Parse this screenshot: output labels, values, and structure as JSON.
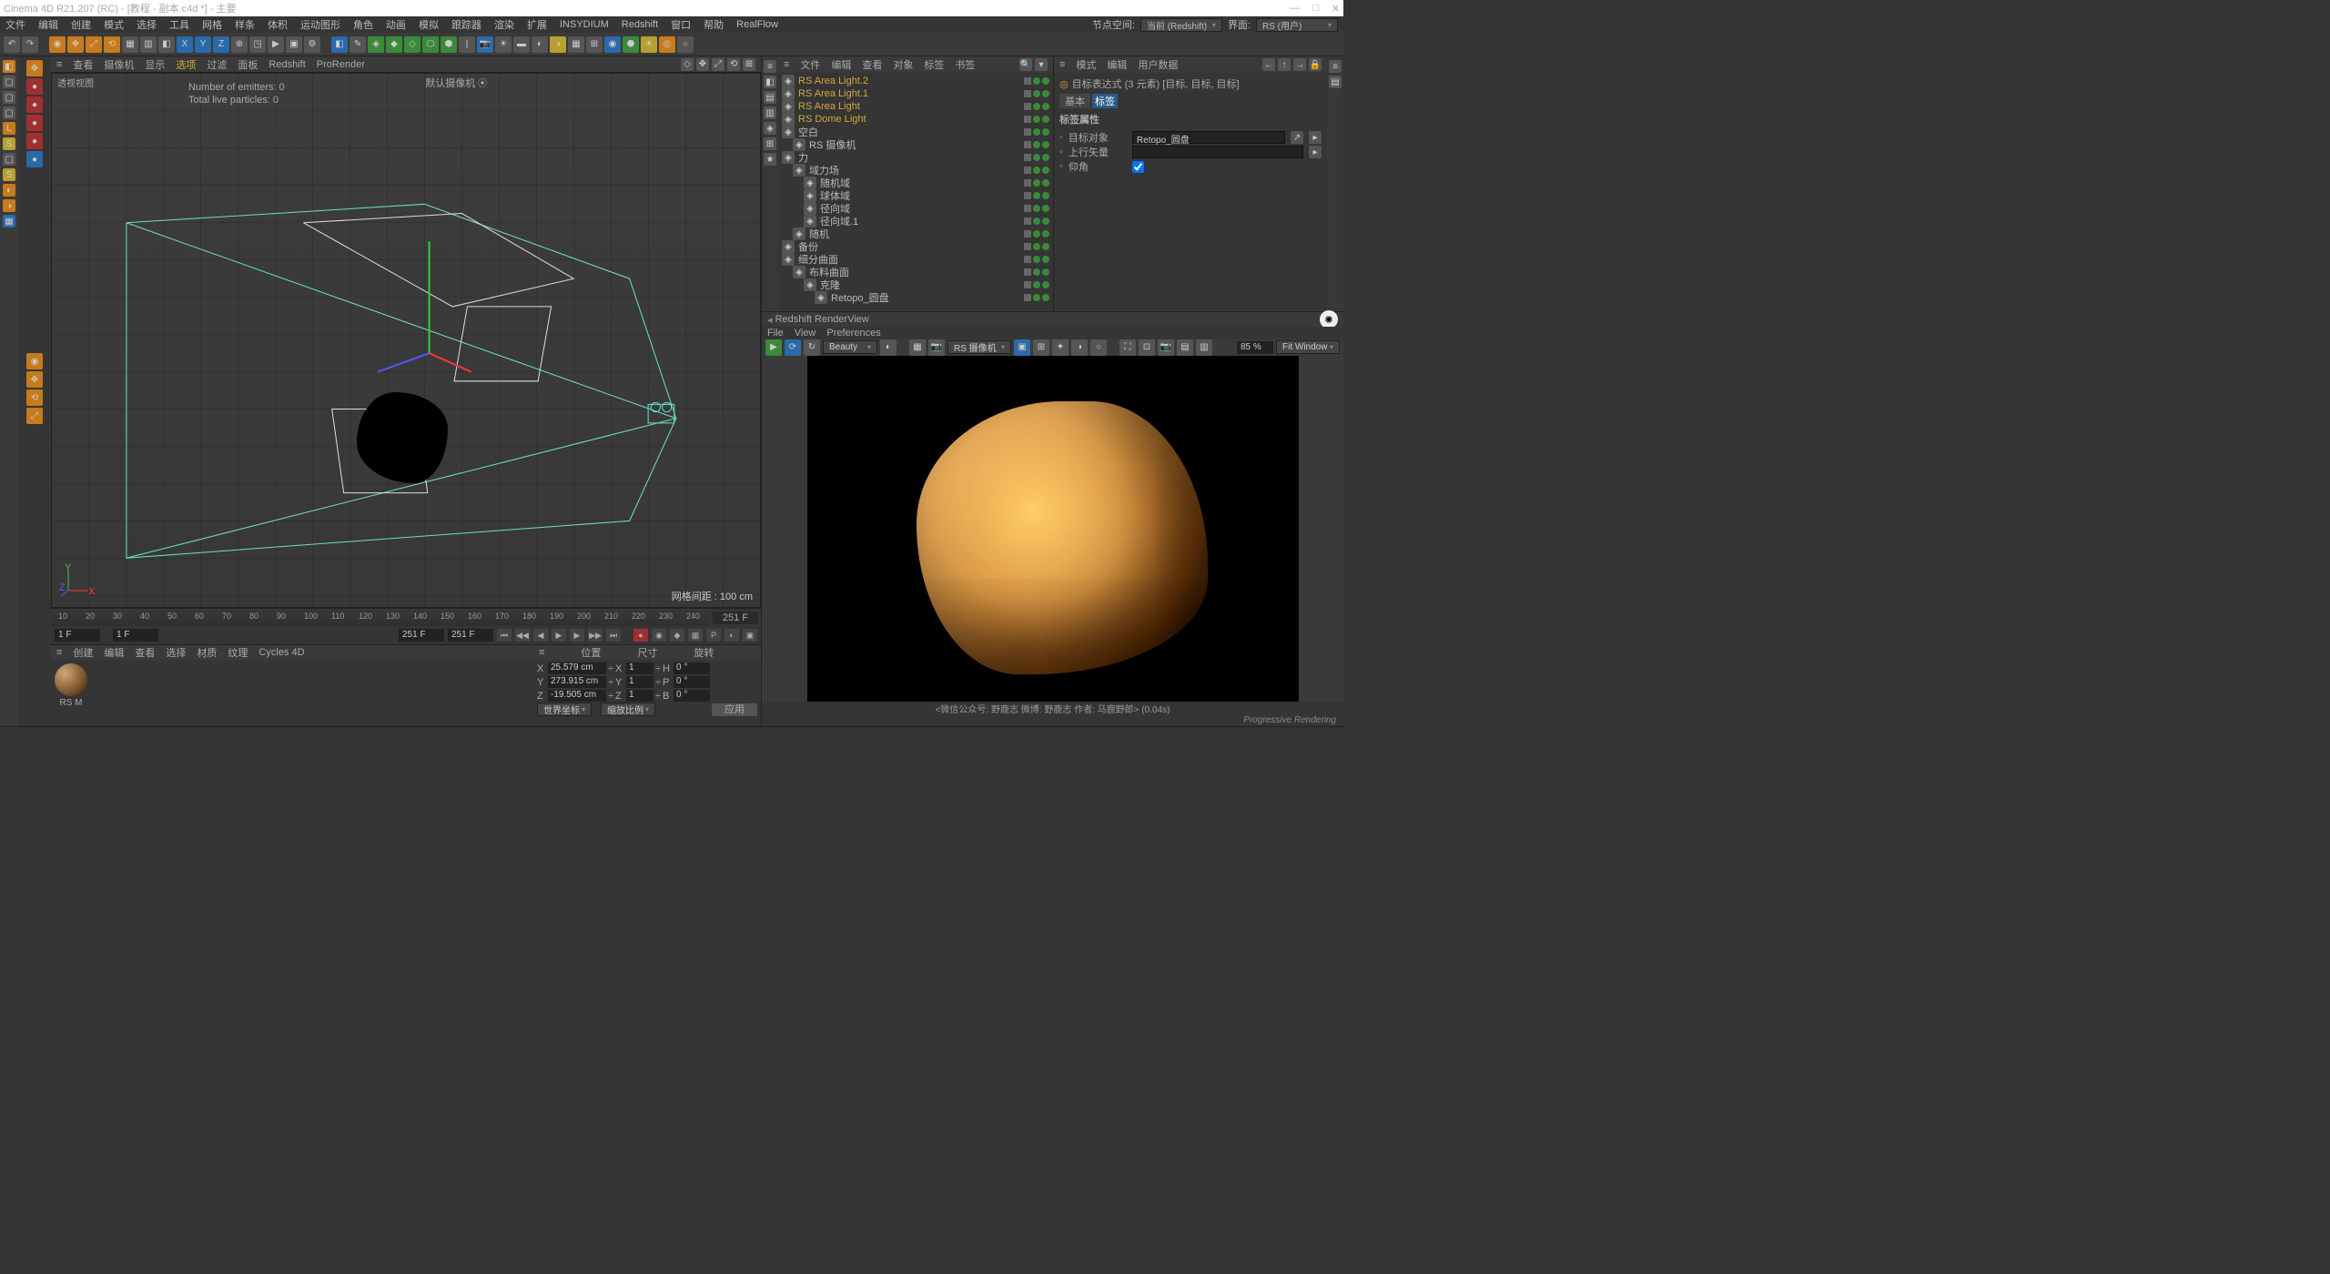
{
  "title": "Cinema 4D R21.207 (RC) - [教程 - 副本.c4d *] - 主要",
  "menu": [
    "文件",
    "编辑",
    "创建",
    "模式",
    "选择",
    "工具",
    "网格",
    "样条",
    "体积",
    "运动图形",
    "角色",
    "动画",
    "模拟",
    "跟踪器",
    "渲染",
    "扩展",
    "INSYDIUM",
    "Redshift",
    "窗口",
    "帮助",
    "RealFlow"
  ],
  "menuRight": {
    "nodeSpace": "节点空间:",
    "nodeSpaceVal": "当前 (Redshift)",
    "layout": "界面:",
    "layoutVal": "RS (用户)"
  },
  "vpMenu": [
    "查看",
    "摄像机",
    "显示",
    "选项",
    "过滤",
    "面板",
    "Redshift",
    "ProRender"
  ],
  "vpLabel": "透视视图",
  "vpCam": "默认摄像机",
  "emit": {
    "l1": "Number of emitters: 0",
    "l2": "Total live particles: 0"
  },
  "gridInfo": "网格间距 : 100 cm",
  "objTabs": [
    "文件",
    "编辑",
    "查看",
    "对象",
    "标签",
    "书签"
  ],
  "objects": [
    {
      "n": "RS Area Light.2",
      "cls": "or",
      "i": 0
    },
    {
      "n": "RS Area Light.1",
      "cls": "or",
      "i": 0
    },
    {
      "n": "RS Area Light",
      "cls": "or",
      "i": 0
    },
    {
      "n": "RS Dome Light",
      "cls": "or",
      "i": 0
    },
    {
      "n": "空白",
      "i": 0
    },
    {
      "n": "RS 摄像机",
      "i": 1
    },
    {
      "n": "力",
      "i": 0
    },
    {
      "n": "域力场",
      "i": 1
    },
    {
      "n": "随机域",
      "i": 2
    },
    {
      "n": "球体域",
      "i": 2
    },
    {
      "n": "径向域",
      "i": 2
    },
    {
      "n": "径向域.1",
      "i": 2
    },
    {
      "n": "随机",
      "i": 1
    },
    {
      "n": "备份",
      "i": 0
    },
    {
      "n": "细分曲面",
      "i": 0
    },
    {
      "n": "布料曲面",
      "i": 1
    },
    {
      "n": "克隆",
      "i": 2
    },
    {
      "n": "Retopo_圆盘",
      "i": 3
    }
  ],
  "attrTabs": [
    "模式",
    "编辑",
    "用户数据"
  ],
  "attrTitle": "目标表达式 (3 元素) [目标, 目标, 目标]",
  "attrSubTabs": {
    "a": "基本",
    "b": "标签"
  },
  "attrSection": "标签属性",
  "attrRows": {
    "target": "目标对象",
    "targetVal": "Retopo_圆盘",
    "up": "上行矢量",
    "pitch": "仰角"
  },
  "rv": {
    "title": "Redshift RenderView",
    "menu": [
      "File",
      "View",
      "Preferences"
    ],
    "aov": "Beauty",
    "cam": "RS 摄像机",
    "pct": "85 %",
    "fit": "Fit Window",
    "status": "<微信公众号: 野鹿志   微博: 野鹿志   作者: 马鹿野郎>  (0.04s)",
    "footer": "Progressive Rendering"
  },
  "timeline": {
    "ticks": [
      10,
      20,
      30,
      40,
      50,
      60,
      70,
      80,
      90,
      100,
      110,
      120,
      130,
      140,
      150,
      160,
      170,
      180,
      190,
      200,
      210,
      220,
      230,
      240
    ],
    "end": "251 F",
    "cur": "1 F",
    "curEnd": "251 F",
    "r2": "251 F"
  },
  "matTabs": [
    "创建",
    "编辑",
    "查看",
    "选择",
    "材质",
    "纹理",
    "Cycles 4D"
  ],
  "matName": "RS M",
  "coord": {
    "hdr": [
      "位置",
      "尺寸",
      "旋转"
    ],
    "rows": [
      {
        "a": "X",
        "v": "25.579 cm",
        "b": "X",
        "s": "1",
        "c": "H",
        "r": "0 °"
      },
      {
        "a": "Y",
        "v": "273.915 cm",
        "b": "Y",
        "s": "1",
        "c": "P",
        "r": "0 °"
      },
      {
        "a": "Z",
        "v": "-19.505 cm",
        "b": "Z",
        "s": "1",
        "c": "B",
        "r": "0 °"
      }
    ],
    "world": "世界坐标",
    "scale": "缩放比例",
    "apply": "应用"
  }
}
